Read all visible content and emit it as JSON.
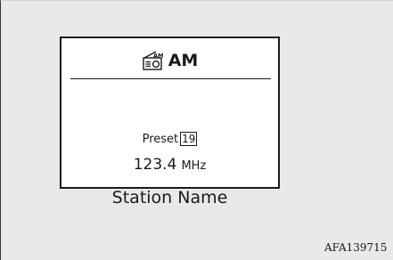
{
  "display": {
    "band_label": "AM",
    "band_icon": "am-radio-icon",
    "preset_label": "Preset",
    "preset_number": "19",
    "frequency_value": "123.4",
    "frequency_unit": "MHz",
    "station_name": "Station Name"
  },
  "figure_code": "AFA139715"
}
